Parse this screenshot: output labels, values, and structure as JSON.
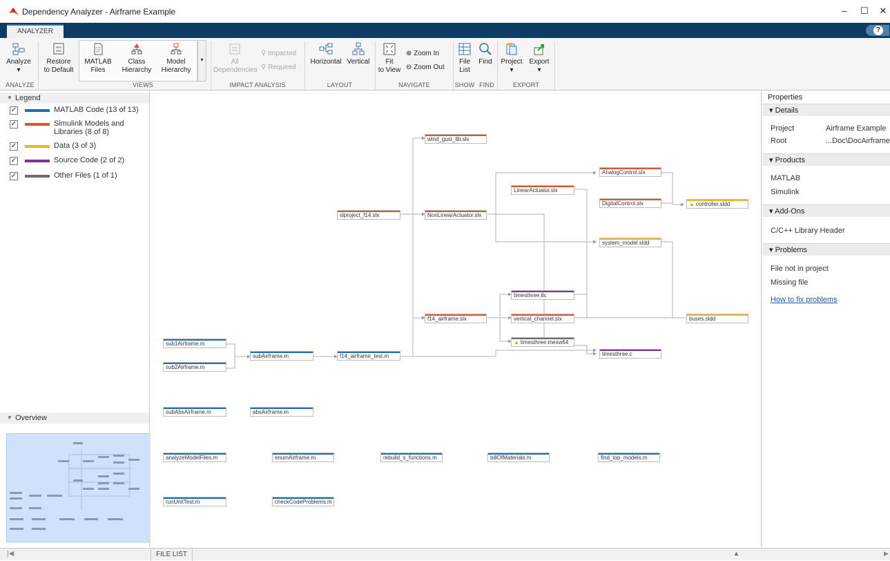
{
  "window": {
    "title": "Dependency Analyzer - Airframe Example",
    "minimize": "–",
    "maximize": "☐",
    "close": "✕"
  },
  "tabs": [
    {
      "label": "ANALYZER"
    }
  ],
  "help": "?",
  "toolstrip": {
    "analyze": {
      "label": "Analyze",
      "arrow": "▾"
    },
    "restore": {
      "line1": "Restore",
      "line2": "to Default"
    },
    "matlab_files": {
      "line1": "MATLAB",
      "line2": "Files"
    },
    "class_hierarchy": {
      "line1": "Class",
      "line2": "Hierarchy"
    },
    "model_hierarchy": {
      "line1": "Model",
      "line2": "Hierarchy"
    },
    "views_more": "▾",
    "all_dependencies": {
      "line1": "All",
      "line2": "Dependencies"
    },
    "impacted": "Impacted",
    "required": "Required",
    "horizontal": "Horizontal",
    "vertical": "Vertical",
    "fit_to_view": {
      "line1": "Fit",
      "line2": "to View"
    },
    "zoom_in": "Zoom In",
    "zoom_out": "Zoom Out",
    "file_list": {
      "line1": "File",
      "line2": "List"
    },
    "find": "Find",
    "project": {
      "label": "Project",
      "arrow": "▾"
    },
    "export": {
      "label": "Export",
      "arrow": "▾"
    },
    "sections": {
      "analyze": "ANALYZE",
      "views": "VIEWS",
      "impact": "IMPACT ANALYSIS",
      "layout": "LAYOUT",
      "navigate": "NAVIGATE",
      "show": "SHOW",
      "find": "FIND",
      "export": "EXPORT"
    }
  },
  "legend": {
    "title": "Legend",
    "collapse_icon": "▼",
    "check": "✓",
    "items": [
      {
        "label": "MATLAB Code (13 of 13)",
        "color": "#1f6fb5"
      },
      {
        "label": "Simulink Models and Libraries (8 of 8)",
        "color": "#d9572b"
      },
      {
        "label": "Data (3 of 3)",
        "color": "#f0b428"
      },
      {
        "label": "Source Code (2 of 2)",
        "color": "#7d3497"
      },
      {
        "label": "Other Files (1 of 1)",
        "color": "#6b6b6b"
      }
    ]
  },
  "overview": {
    "title": "Overview"
  },
  "graph": {
    "colors": {
      "matlab": "#1f6fb5",
      "simulink": "#d9572b",
      "data": "#f0b428",
      "source": "#7d3497",
      "other": "#6b6b6b"
    },
    "nodes": [
      {
        "label": "wind_gust_lib.slx",
        "kind": "simulink",
        "warn": false
      },
      {
        "label": "slproject_f14.slx",
        "kind": "simulink",
        "warn": false
      },
      {
        "label": "NonLinearActuator.slx",
        "kind": "simulink",
        "warn": false
      },
      {
        "label": "AnalogControl.slx",
        "kind": "simulink",
        "warn": false
      },
      {
        "label": "LinearActuator.slx",
        "kind": "simulink",
        "warn": false
      },
      {
        "label": "DigitalControl.slx",
        "kind": "simulink",
        "warn": false
      },
      {
        "label": "controller.sldd",
        "kind": "data",
        "warn": true
      },
      {
        "label": "system_model.sldd",
        "kind": "data",
        "warn": false
      },
      {
        "label": "timesthree.tlc",
        "kind": "source",
        "warn": false
      },
      {
        "label": "f14_airframe.slx",
        "kind": "simulink",
        "warn": false
      },
      {
        "label": "vertical_channel.slx",
        "kind": "simulink",
        "warn": false
      },
      {
        "label": "buses.sldd",
        "kind": "data",
        "warn": false
      },
      {
        "label": "timesthree.mexw64",
        "kind": "other",
        "warn": true
      },
      {
        "label": "timesthree.c",
        "kind": "source",
        "warn": false
      },
      {
        "label": "sub1Airframe.m",
        "kind": "matlab",
        "warn": false
      },
      {
        "label": "subAirframe.m",
        "kind": "matlab",
        "warn": false
      },
      {
        "label": "f14_airframe_test.m",
        "kind": "matlab",
        "warn": false
      },
      {
        "label": "sub2Airframe.m",
        "kind": "matlab",
        "warn": false
      },
      {
        "label": "subAbsAirframe.m",
        "kind": "matlab",
        "warn": false
      },
      {
        "label": "absAirframe.m",
        "kind": "matlab",
        "warn": false
      },
      {
        "label": "analyzeModelFiles.m",
        "kind": "matlab",
        "warn": false
      },
      {
        "label": "enumAirframe.m",
        "kind": "matlab",
        "warn": false
      },
      {
        "label": "rebuild_s_functions.m",
        "kind": "matlab",
        "warn": false
      },
      {
        "label": "billOfMaterials.m",
        "kind": "matlab",
        "warn": false
      },
      {
        "label": "find_top_models.m",
        "kind": "matlab",
        "warn": false
      },
      {
        "label": "runUnitTest.m",
        "kind": "matlab",
        "warn": false
      },
      {
        "label": "checkCodeProblems.m",
        "kind": "matlab",
        "warn": false
      }
    ]
  },
  "properties": {
    "title": "Properties",
    "details": {
      "header": "Details",
      "project_label": "Project",
      "project_value": "Airframe Example",
      "root_label": "Root",
      "root_value": "...Doc\\DocAirframe"
    },
    "products": {
      "header": "Products",
      "items": [
        "MATLAB",
        "Simulink"
      ]
    },
    "addons": {
      "header": "Add-Ons",
      "items": [
        "C/C++ Library Header"
      ]
    },
    "problems": {
      "header": "Problems",
      "items": [
        "File not in project",
        "Missing file"
      ],
      "link": "How to fix problems"
    }
  },
  "bottom": {
    "file_list": "FILE LIST",
    "left_icon": "|◀",
    "right_icon": "▶",
    "splitter_icon": "▲"
  }
}
